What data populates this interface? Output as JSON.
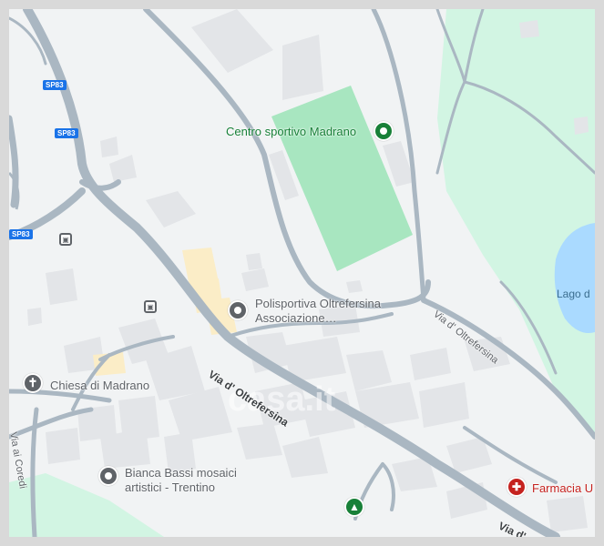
{
  "map": {
    "colors": {
      "background": "#f1f3f4",
      "road": "#aab7c2",
      "road_casing": "#9aa8b4",
      "building": "#e3e5e8",
      "building_highlight": "#fbedc7",
      "green": "#d2f5e3",
      "pitch": "#a8e6c0",
      "water": "#aadaff",
      "poi_gray": "#5f6368",
      "park_green": "#188038",
      "pharmacy_red": "#c5221f",
      "shield_blue": "#1a73e8"
    },
    "places": {
      "sport_center": "Centro sportivo Madrano",
      "polisportiva_line1": "Polisportiva Oltrefersina",
      "polisportiva_line2": "Associazione…",
      "church": "Chiesa di Madrano",
      "mosaics_line1": "Bianca Bassi mosaici",
      "mosaics_line2": "artistici - Trentino",
      "pharmacy": "Farmacia U",
      "lake": "Lago d"
    },
    "streets": {
      "via_oltrefersina_main": "Via d' Oltrefersina",
      "via_oltrefersina_east": "Via d' Oltrefersina",
      "via_ai_coredi": "Via ai Coredi",
      "via_bottom": "Via d'"
    },
    "shields": {
      "sp83_a": "SP83",
      "sp83_b": "SP83",
      "sp83_c": "SP83"
    },
    "icons": {
      "sport": "sport-pin-icon",
      "poi": "poi-pin-icon",
      "church": "cross-pin-icon",
      "park": "tree-pin-icon",
      "pharmacy": "pharmacy-pin-icon",
      "bus": "bus-stop-icon"
    },
    "watermark": "casa.it"
  }
}
